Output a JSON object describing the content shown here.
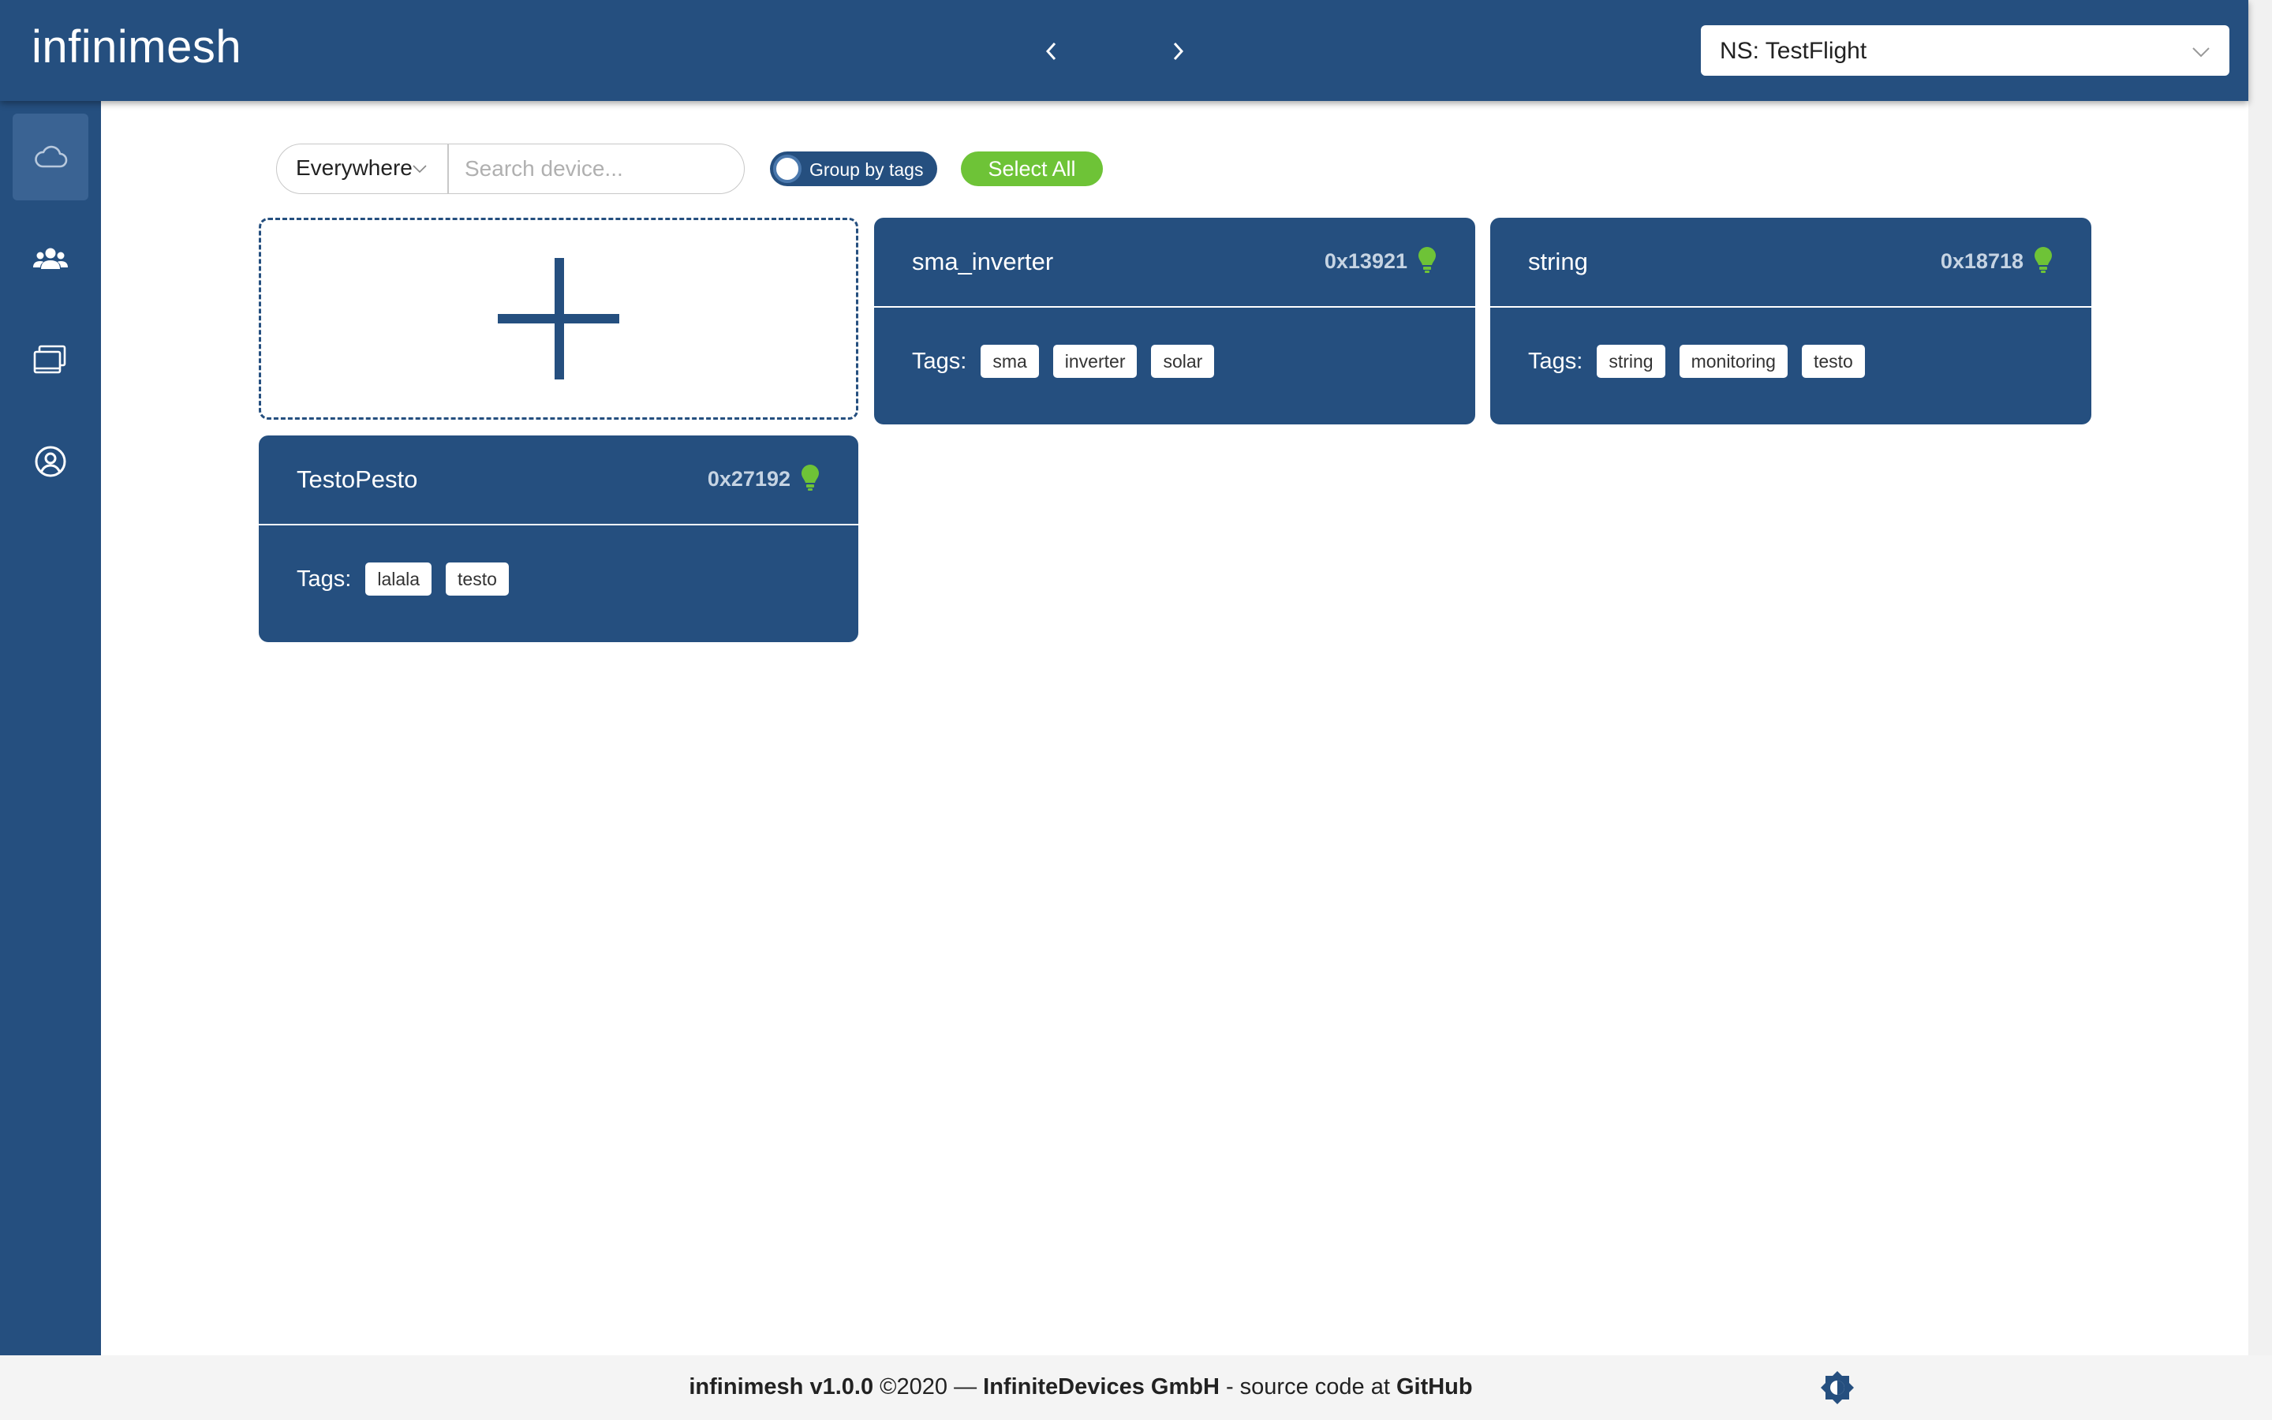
{
  "header": {
    "logo": "infinimesh",
    "namespace_select": "NS: TestFlight",
    "nav_icons": [
      "chevron-left-icon",
      "chevron-right-icon"
    ]
  },
  "sidebar": {
    "items": [
      {
        "icon": "cloud-icon",
        "active": true
      },
      {
        "icon": "users-icon",
        "active": false
      },
      {
        "icon": "folders-icon",
        "active": false
      },
      {
        "icon": "user-account-icon",
        "active": false
      }
    ]
  },
  "toolbar": {
    "scope_label": "Everywhere",
    "search_placeholder": "Search device...",
    "group_by_tags_label": "Group by tags",
    "select_all_label": "Select All"
  },
  "devices": [
    {
      "name": "sma_inverter",
      "id": "0x13921",
      "tags_label": "Tags:",
      "tags": [
        "sma",
        "inverter",
        "solar"
      ]
    },
    {
      "name": "string",
      "id": "0x18718",
      "tags_label": "Tags:",
      "tags": [
        "string",
        "monitoring",
        "testo"
      ]
    },
    {
      "name": "TestoPesto",
      "id": "0x27192",
      "tags_label": "Tags:",
      "tags": [
        "lalala",
        "testo"
      ]
    }
  ],
  "footer": {
    "product": "infinimesh v1.0.0",
    "copyright": " ©2020 — ",
    "company": "InfiniteDevices GmbH",
    "source_text": " - source code at ",
    "github": "GitHub"
  },
  "colors": {
    "primary": "#254f7f",
    "accent_green": "#6ec337",
    "sidebar_active": "#3a6393"
  }
}
